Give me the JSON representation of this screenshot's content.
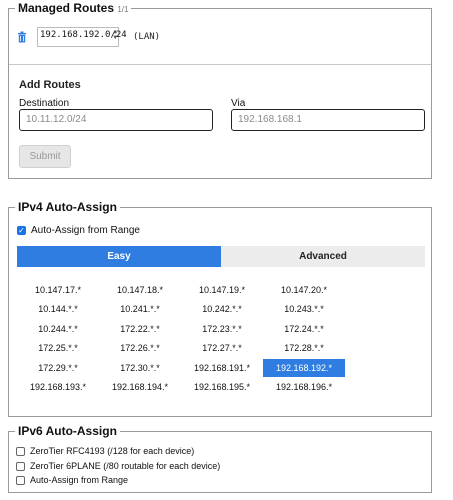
{
  "managed_routes": {
    "legend": "Managed Routes",
    "count": "1/1",
    "routes": [
      {
        "target": "192.168.192.0/24",
        "via": "(LAN)"
      }
    ],
    "add_routes": {
      "title": "Add Routes",
      "destination_label": "Destination",
      "destination_placeholder": "10.11.12.0/24",
      "via_label": "Via",
      "via_placeholder": "192.168.168.1",
      "submit_label": "Submit"
    }
  },
  "ipv4": {
    "legend": "IPv4 Auto-Assign",
    "auto_assign_label": "Auto-Assign from Range",
    "auto_assign_checked": true,
    "tabs": {
      "easy": "Easy",
      "advanced": "Advanced",
      "active": "easy"
    },
    "ranges": [
      [
        "10.147.17.*",
        "10.147.18.*",
        "10.147.19.*",
        "10.147.20.*"
      ],
      [
        "10.144.*.*",
        "10.241.*.*",
        "10.242.*.*",
        "10.243.*.*"
      ],
      [
        "10.244.*.*",
        "172.22.*.*",
        "172.23.*.*",
        "172.24.*.*"
      ],
      [
        "172.25.*.*",
        "172.26.*.*",
        "172.27.*.*",
        "172.28.*.*"
      ],
      [
        "172.29.*.*",
        "172.30.*.*",
        "192.168.191.*",
        "192.168.192.*"
      ],
      [
        "192.168.193.*",
        "192.168.194.*",
        "192.168.195.*",
        "192.168.196.*"
      ]
    ],
    "selected_range": "192.168.192.*",
    "accent": "#2f7de1"
  },
  "ipv6": {
    "legend": "IPv6 Auto-Assign",
    "options": [
      {
        "label": "ZeroTier RFC4193 (/128 for each device)",
        "checked": false
      },
      {
        "label": "ZeroTier 6PLANE (/80 routable for each device)",
        "checked": false
      },
      {
        "label": "Auto-Assign from Range",
        "checked": false
      }
    ]
  }
}
